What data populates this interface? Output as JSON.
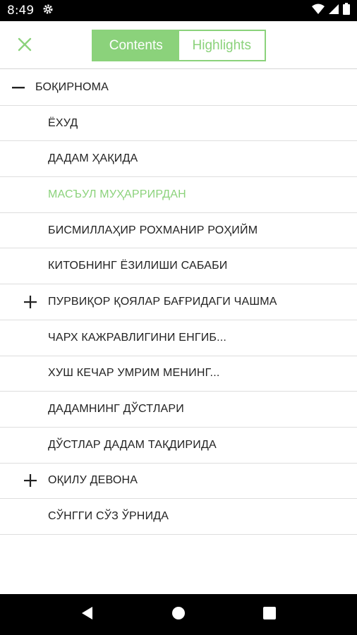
{
  "status_bar": {
    "time": "8:49"
  },
  "toolbar": {
    "tabs": {
      "contents": "Contents",
      "highlights": "Highlights"
    }
  },
  "colors": {
    "accent": "#8bd27b",
    "text": "#222222",
    "divider": "#dedede"
  },
  "toc": [
    {
      "label": "БОҚИРНОМА",
      "level": 0,
      "toggle": "minus",
      "selected": false
    },
    {
      "label": "ЁХУД",
      "level": 1,
      "toggle": "none",
      "selected": false
    },
    {
      "label": "ДАДАМ ҲАҚИДА",
      "level": 1,
      "toggle": "none",
      "selected": false
    },
    {
      "label": "МАСЪУЛ МУҲАРРИРДАН",
      "level": 1,
      "toggle": "none",
      "selected": true
    },
    {
      "label": "БИСМИЛЛАҲИР РОХМАНИР РОҲИЙМ",
      "level": 1,
      "toggle": "none",
      "selected": false
    },
    {
      "label": "КИТОБНИНГ ЁЗИЛИШИ САБАБИ",
      "level": 1,
      "toggle": "none",
      "selected": false
    },
    {
      "label": "ПУРВИҚОР ҚОЯЛАР БАҒРИДАГИ ЧАШМА",
      "level": 1,
      "toggle": "plus",
      "selected": false
    },
    {
      "label": "ЧАРХ КАЖРАВЛИГИНИ ЕНГИБ...",
      "level": 1,
      "toggle": "none",
      "selected": false
    },
    {
      "label": "ХУШ КЕЧАР УМРИМ МЕНИНГ...",
      "level": 1,
      "toggle": "none",
      "selected": false
    },
    {
      "label": "ДАДАМНИНГ ДЎСТЛАРИ",
      "level": 1,
      "toggle": "none",
      "selected": false
    },
    {
      "label": "ДЎСТЛАР ДАДАМ ТАҚДИРИДА",
      "level": 1,
      "toggle": "none",
      "selected": false
    },
    {
      "label": "ОҚИЛУ ДЕВОНА",
      "level": 1,
      "toggle": "plus",
      "selected": false
    },
    {
      "label": "СЎНГГИ СЎЗ ЎРНИДА",
      "level": 1,
      "toggle": "none",
      "selected": false
    }
  ]
}
